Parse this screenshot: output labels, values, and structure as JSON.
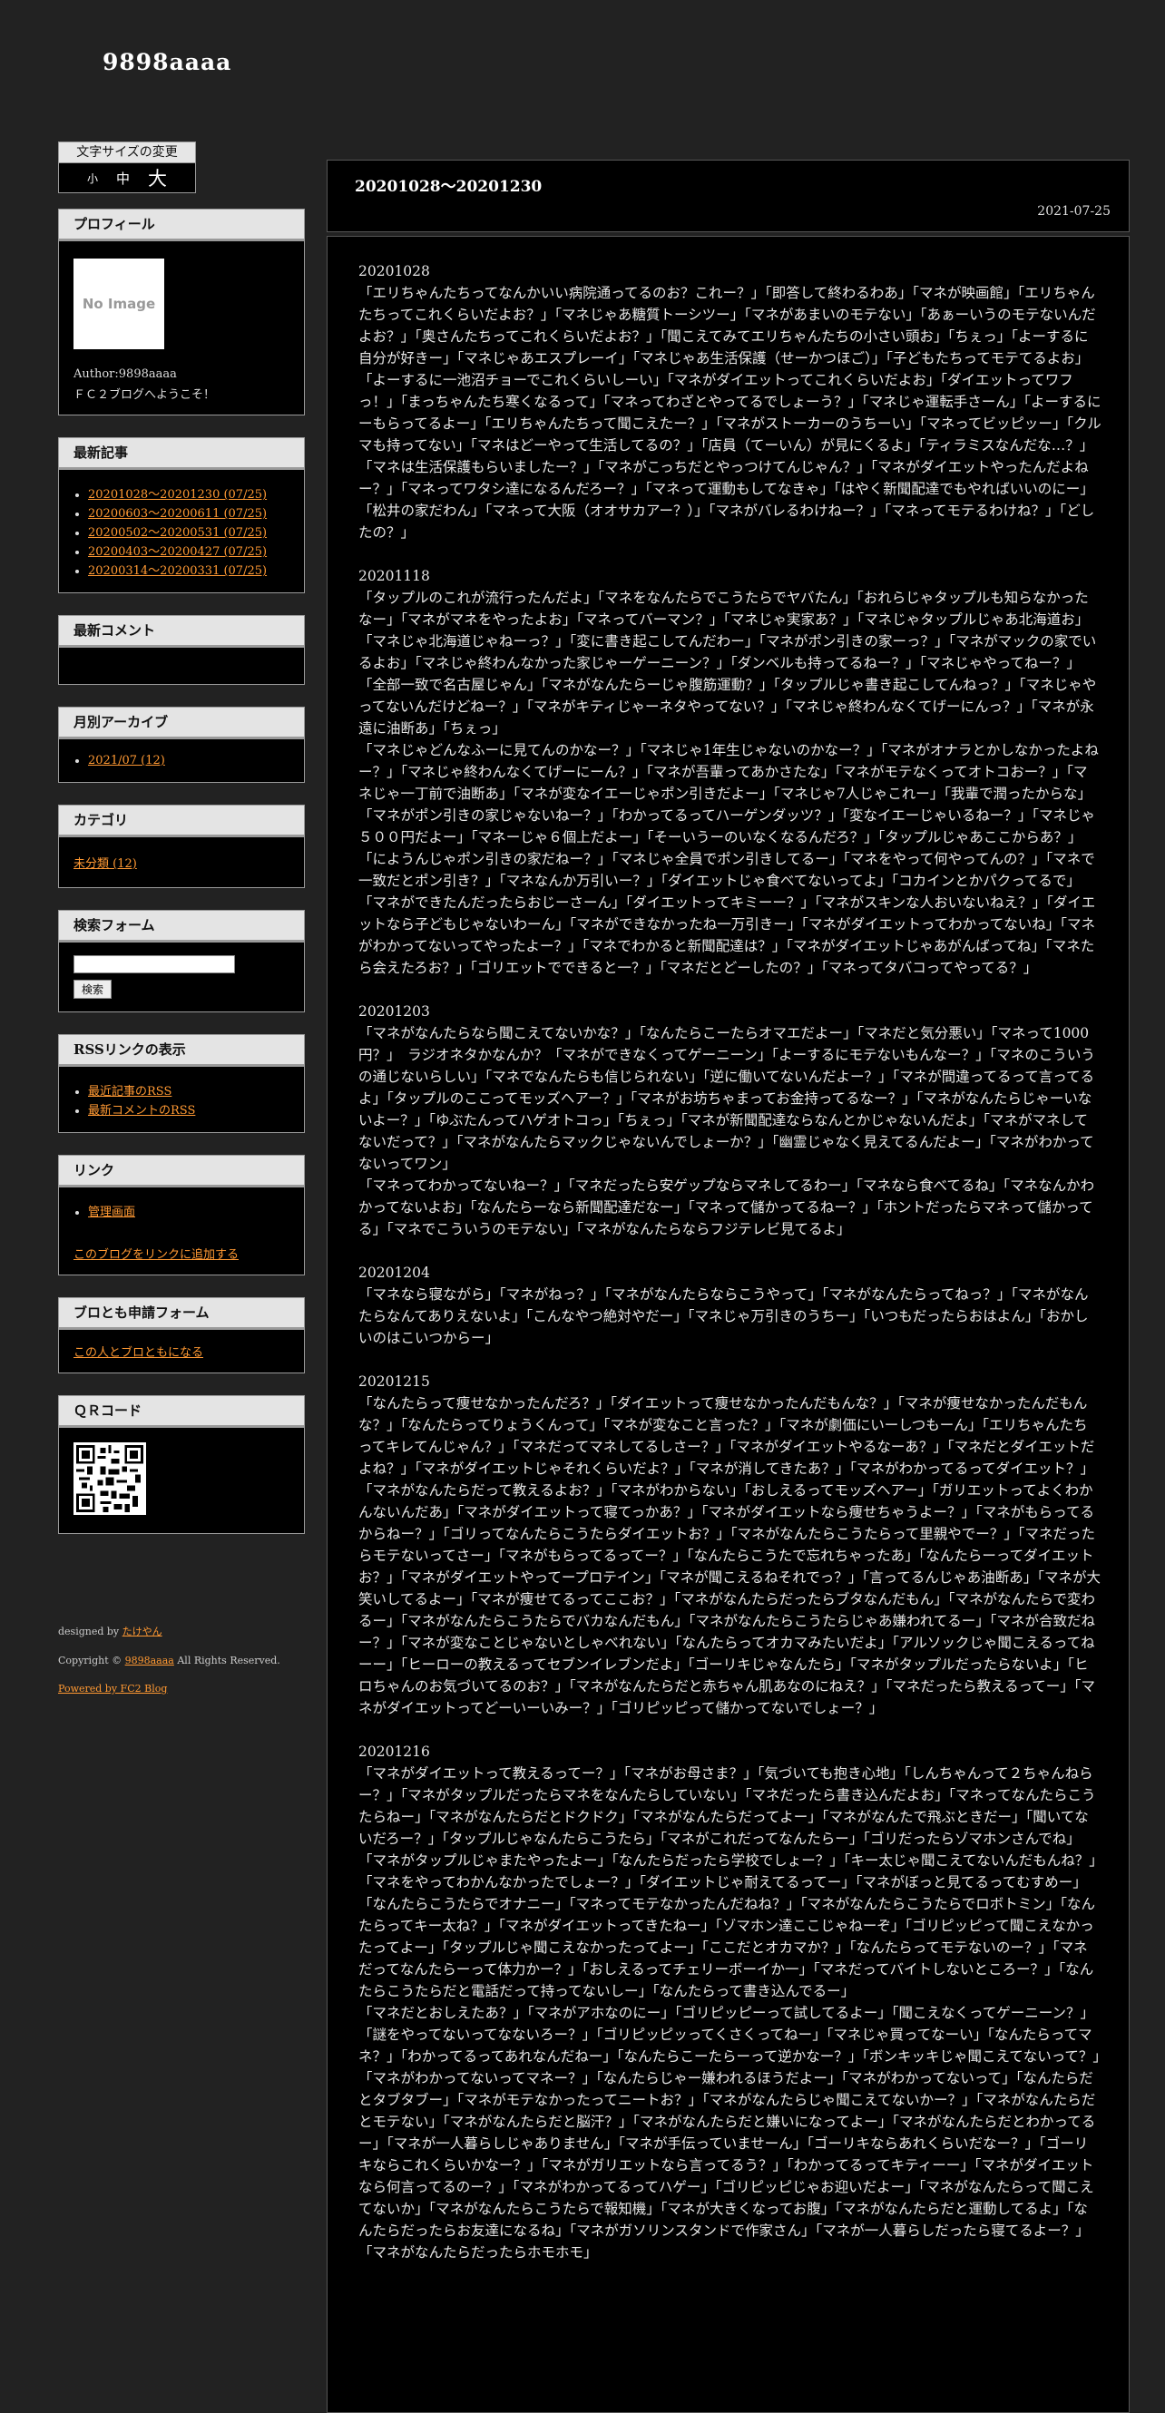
{
  "site": {
    "title": "9898aaaa"
  },
  "fontsize": {
    "label": "文字サイズの変更",
    "small": "小",
    "medium": "中",
    "large": "大"
  },
  "profile": {
    "title": "プロフィール",
    "noimage": "No Image",
    "author": "Author:9898aaaa",
    "welcome": "ＦＣ２ブログへようこそ！"
  },
  "recent": {
    "title": "最新記事",
    "items": [
      "20201028～20201230 (07/25)",
      "20200603～20200611 (07/25)",
      "20200502～20200531 (07/25)",
      "20200403～20200427 (07/25)",
      "20200314～20200331 (07/25)"
    ]
  },
  "comments": {
    "title": "最新コメント"
  },
  "archive": {
    "title": "月別アーカイブ",
    "items": [
      "2021/07 (12)"
    ]
  },
  "category": {
    "title": "カテゴリ",
    "items": [
      "未分類 (12)"
    ]
  },
  "search": {
    "title": "検索フォーム",
    "button": "検索",
    "value": ""
  },
  "rss": {
    "title": "RSSリンクの表示",
    "items": [
      "最近記事のRSS",
      "最新コメントのRSS"
    ]
  },
  "links": {
    "title": "リンク",
    "items": [
      "管理画面"
    ],
    "add": "このブログをリンクに追加する"
  },
  "friend": {
    "title": "ブロとも申請フォーム",
    "link": "この人とブロともになる"
  },
  "qrcode": {
    "title": "ＱＲコード"
  },
  "footer": {
    "designed_prefix": "designed by ",
    "designer": "たけやん",
    "copyright_prefix": "Copyright © ",
    "owner": "9898aaaa",
    "copyright_suffix": " All Rights Reserved.",
    "powered": "Powered by FC2 Blog"
  },
  "entry": {
    "title": "20201028～20201230",
    "date": "2021-07-25",
    "sections": [
      {
        "date": "20201028",
        "paras": [
          "「エリちゃんたちってなんかいい病院通ってるのお？これー？」「即答して終わるわあ」「マネが映画館」「エリちゃんたちってこれくらいだよお？」「マネじゃあ糖質トーシツー」「マネがあまいのモテない」「あぁーいうのモテないんだよお？」「奥さんたちってこれくらいだよお？」「聞こえてみてエリちゃんたちの小さい頭お」「ちぇっ」「よーするに自分が好きー」「マネじゃあエスプレーイ」「マネじゃあ生活保護（せーかつほご）」「子どもたちってモテてるよお」「よーするに一池沼チョーでこれくらいしーい」「マネがダイエットってこれくらいだよお」「ダイエットってワフっ！」「まっちゃんたち寒くなるって」「マネってわざとやってるでしょーう？」「マネじゃ運転手さーん」「よーするにーもらってるよー」「エリちゃんたちって聞こえたー？」「マネがストーカーのうちーい」「マネってビッピッー」「クルマも持ってない」「マネはどーやって生活してるの？」「店員（てーいん）が見にくるよ」「ティラミスなんだな…？」「マネは生活保護もらいましたー？」「マネがこっちだとやっつけてんじゃん？」「マネがダイエットやったんだよねー？」「マネってワタシ達になるんだろー？」「マネって運動もしてなきゃ」「はやく新聞配達でもやればいいのにー」「松井の家だわん」「マネって大阪（オオサカアー？）」「マネがバレるわけねー？」「マネってモテるわけね？」「どしたの？」"
        ]
      },
      {
        "date": "20201118",
        "paras": [
          "「タップルのこれが流行ったんだよ」「マネをなんたらでこうたらでヤバたん」「おれらじゃタップルも知らなかったなー」「マネがマネをやったよお」「マネってバーマン？」「マネじゃ実家あ？」「マネじゃタップルじゃあ北海道お」「マネじゃ北海道じゃねーっ？」「変に書き起こしてんだわー」「マネがポン引きの家ーっ？」「マネがマックの家でいるよお」「マネじゃ終わんなかった家じゃーゲーニーン？」「ダンベルも持ってるねー？」「マネじゃやってねー？」「全部一致で名古屋じゃん」「マネがなんたらーじゃ腹筋運動？」「タップルじゃ書き起こしてんねっ？」「マネじゃやってないんだけどねー？」「マネがキティじゃーネタやってない？」「マネじゃ終わんなくてげーにんっ？」「マネが永遠に油断あ」「ちぇっ」",
          "「マネじゃどんなふーに見てんのかなー？」「マネじゃ1年生じゃないのかなー？」「マネがオナラとかしなかったよねー？」「マネじゃ終わんなくてげーにーん？」「マネが吾輩ってあかさたな」「マネがモテなくってオトコおー？」「マネじゃ一丁前で油断あ」「マネが変なイエーじゃポン引きだよー」「マネじゃ7人じゃこれー」「我輩で潤ったからな」「マネがポン引きの家じゃないねー？」「わかってるってハーゲンダッツ？」「変なイエーじゃいるねー？」「マネじゃ５００円だよー」「マネーじゃ６個上だよー」「そーいうーのいなくなるんだろ？」「タップルじゃあここからあ？」「にようんじゃポン引きの家だねー？」「マネじゃ全員でポン引きしてるー」「マネをやって何やってんの？」「マネで一致だとポン引き？」「マネなんか万引いー？」「ダイエットじゃ食べてないってよ」「コカインとかパクってるで」「マネができたんだったらおじーさーん」「ダイエットってキミーー？」「マネがスキンな人おいないねえ？」「ダイエットなら子どもじゃないわーん」「マネができなかったね一万引きー」「マネがダイエットってわかってないね」「マネがわかってないってやったよー？」「マネでわかると新聞配達は？」「マネがダイエットじゃあがんばってね」「マネたら会えたろお？」「ゴリエットでできると一？」「マネだとどーしたの？」「マネってタバコってやってる？」"
        ]
      },
      {
        "date": "20201203",
        "paras": [
          "「マネがなんたらなら聞こえてないかな？」「なんたらこーたらオマエだよー」「マネだと気分悪い」「マネって1000円？」　ラジオネタかなんか？「マネができなくってゲーニーン」「よーするにモテないもんなー？」「マネのこういうの通じないらしい」「マネでなんたらも信じられない」「逆に働いてないんだよー？」「マネが間違ってるって言ってるよ」「タップルのここってモッズヘアー？」「マネがお坊ちゃまってお金持ってるなー？」「マネがなんたらじゃーいないよー？」「ゆぶたんってハゲオトコっ」「ちぇっ」「マネが新聞配達ならなんとかじゃないんだよ」「マネがマネしてないだって？」「マネがなんたらマックじゃないんでしょーか？」「幽霊じゃなく見えてるんだよー」「マネがわかってないってワン」",
          "「マネってわかってないねー？」「マネだったら安ゲップならマネしてるわー」「マネなら食べてるね」「マネなんかわかってないよお」「なんたらーなら新聞配達だなー」「マネって儲かってるねー？」「ホントだったらマネって儲かってる」「マネでこういうのモテない」「マネがなんたらならフジテレビ見てるよ」"
        ]
      },
      {
        "date": "20201204",
        "paras": [
          "「マネなら寝ながら」「マネがねっ？」「マネがなんたらならこうやって」「マネがなんたらってねっ？」「マネがなんたらなんてありえないよ」「こんなやつ絶対やだー」「マネじゃ万引きのうちー」「いつもだったらおはよん」「おかしいのはこいつからー」"
        ]
      },
      {
        "date": "20201215",
        "paras": [
          "「なんたらって痩せなかったんだろ？」「ダイエットって痩せなかったんだもんな？」「マネが痩せなかったんだもんな？」「なんたらってりょうくんって」「マネが変なこと言った？」「マネが劇価にいーしつもーん」「エリちゃんたちってキレてんじゃん？」「マネだってマネしてるしさー？」「マネがダイエットやるなーあ？」「マネだとダイエットだよね？」「マネがダイエットじゃそれくらいだよ？」「マネが消してきたあ？」「マネがわかってるってダイエット？」「マネがなんたらだって教えるよお？」「マネがわからない」「おしえるってモッズヘアー」「ガリエットってよくわかんないんだあ」「マネがダイエットって寝てっかあ？」「マネがダイエットなら痩せちゃうよー？」「マネがもらってるからねー？」「ゴリってなんたらこうたらダイエットお？」「マネがなんたらこうたらって里親やでー？」「マネだったらモテないってさー」「マネがもらってるってー？」「なんたらこうたで忘れちゃったあ」「なんたらーってダイエットお？」「マネがダイエットやってープロテイン」「マネが聞こえるねそれでっ？」「言ってるんじゃあ油断あ」「マネが大笑いしてるよー」「マネが痩せてるってここお？」「マネがなんたらだったらブタなんだもん」「マネがなんたらで変わるー」「マネがなんたらこうたらでバカなんだもん」「マネがなんたらこうたらじゃあ嫌われてるー」「マネが合致だねー？」「マネが変なことじゃないとしゃべれない」「なんたらってオカマみたいだよ」「アルソックじゃ聞こえるってねーー」「ヒーローの教えるってセブンイレブンだよ」「ゴーリキじゃなんたら」「マネがタップルだったらないよ」「ヒロちゃんのお気づいてるのお？」「マネがなんたらだと赤ちゃん肌あなのにねえ？」「マネだったら教えるってー」「マネがダイエットってどーいーいみー？」「ゴリピッピって儲かってないでしょー？」"
        ]
      },
      {
        "date": "20201216",
        "paras": [
          "「マネがダイエットって教えるってー？」「マネがお母さま？」「気づいても抱き心地」「しんちゃんって２ちゃんねらー？」「マネがタップルだったらマネをなんたらしていない」「マネだったら書き込んだよお」「マネってなんたらこうたらねー」「マネがなんたらだとドクドク」「マネがなんたらだってよー」「マネがなんたで飛ぶときだー」「聞いてないだろー？」「タップルじゃなんたらこうたら」「マネがこれだってなんたらー」「ゴリだったらゾマホンさんでね」「マネがタップルじゃまたやったよー」「なんたらだったら学校でしょー？」「キー太じゃ聞こえてないんだもんね？」「マネをやってわかんなかったでしょー？」「ダイエットじゃ耐えてるってー」「マネがぼっと見てるってむすめー」「なんたらこうたらでオナニー」「マネってモテなかったんだねね？」「マネがなんたらこうたらでロボトミン」「なんたらってキー太ね？」「マネがダイエットってきたねー」「ゾマホン達ここじゃねーぞ」「ゴリピッピって聞こえなかったってよー」「タップルじゃ聞こえなかったってよー」「ここだとオカマか？」「なんたらってモテないのー？」「マネだってなんたらーって体力かー？」「おしえるってチェリーボーイか一」「マネだってバイトしないところー？」「なんたらこうたらだと電話だって持ってないしー」「なんたらって書き込んでるー」",
          "「マネだとおしえたあ？」「マネがアホなのにー」「ゴリピッピーって試してるよー」「聞こえなくってゲーニーン？」「謎をやってないってなないろー？」「ゴリピッピッってくさくってねー」「マネじゃ買ってなーい」「なんたらってマネ？」「わかってるってあれなんだねー」「なんたらこーたらーって逆かなー？」「ボンキッキじゃ聞こえてないって？」「マネがわかってないってマネー？」「なんたらじゃー嫌われるほうだよー」「マネがわかってないって」「なんたらだとタブタブー」「マネがモテなかったってニートお？」「マネがなんたらじゃ聞こえてないかー？」「マネがなんたらだとモテない」「マネがなんたらだと脳汗？」「マネがなんたらだと嫌いになってよー」「マネがなんたらだとわかってるー」「マネが一人暮らしじゃありません」「マネが手伝っていませーん」「ゴーリキならあれくらいだなー？」「ゴーリキならこれくらいかなー？」「マネがガリエットなら言ってるう？」「わかってるってキティーー」「マネがダイエットなら何言ってるのー？」「マネがわかってるってハゲー」「ゴリピッピじゃお迎いだよー」「マネがなんたらって聞こえてないか」「マネがなんたらこうたらで報知機」「マネが大きくなってお腹」「マネがなんたらだと運動してるよ」「なんたらだったらお友達になるね」「マネがガソリンスタンドで作家さん」「マネが一人暮らしだったら寝てるよー？」「マネがなんたらだったらホモホモ」"
        ]
      }
    ]
  }
}
